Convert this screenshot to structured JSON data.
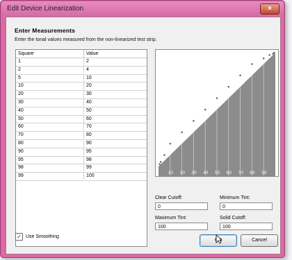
{
  "window": {
    "title": "Edit Device Linearization",
    "close_glyph": "×"
  },
  "heading": "Enter Measurements",
  "instruction": "Enter the tonal values measured from the non-linearized test strip.",
  "table": {
    "columns": [
      "Square",
      "Value"
    ],
    "rows": [
      [
        "1",
        "2"
      ],
      [
        "2",
        "4"
      ],
      [
        "5",
        "10"
      ],
      [
        "10",
        "20"
      ],
      [
        "20",
        "30"
      ],
      [
        "30",
        "40"
      ],
      [
        "40",
        "50"
      ],
      [
        "50",
        "60"
      ],
      [
        "60",
        "70"
      ],
      [
        "70",
        "80"
      ],
      [
        "80",
        "90"
      ],
      [
        "90",
        "95"
      ],
      [
        "95",
        "98"
      ],
      [
        "98",
        "99"
      ],
      [
        "99",
        "100"
      ]
    ]
  },
  "smoothing": {
    "label": "Use Smoothing",
    "checked": true
  },
  "graph": {
    "x_ticks": [
      "10",
      "20",
      "30",
      "40",
      "50",
      "60",
      "70",
      "80",
      "90"
    ],
    "points_x": [
      1,
      2,
      5,
      10,
      20,
      30,
      40,
      50,
      60,
      70,
      80,
      90,
      95,
      98,
      99
    ],
    "points_y": [
      2,
      4,
      10,
      20,
      30,
      40,
      50,
      60,
      70,
      80,
      90,
      95,
      98,
      99,
      100
    ],
    "clear_cutoff": 0,
    "solid_cutoff": 100
  },
  "fields": {
    "clear_cutoff": {
      "label": "Clear Cutoff:",
      "value": "0"
    },
    "minimum_tint": {
      "label": "Minimum Tint:",
      "value": "0"
    },
    "maximum_tint": {
      "label": "Maximum Tint:",
      "value": "100"
    },
    "solid_cutoff": {
      "label": "Solid Cutoff:",
      "value": "100"
    }
  },
  "buttons": {
    "ok": "OK",
    "cancel": "Cancel"
  }
}
